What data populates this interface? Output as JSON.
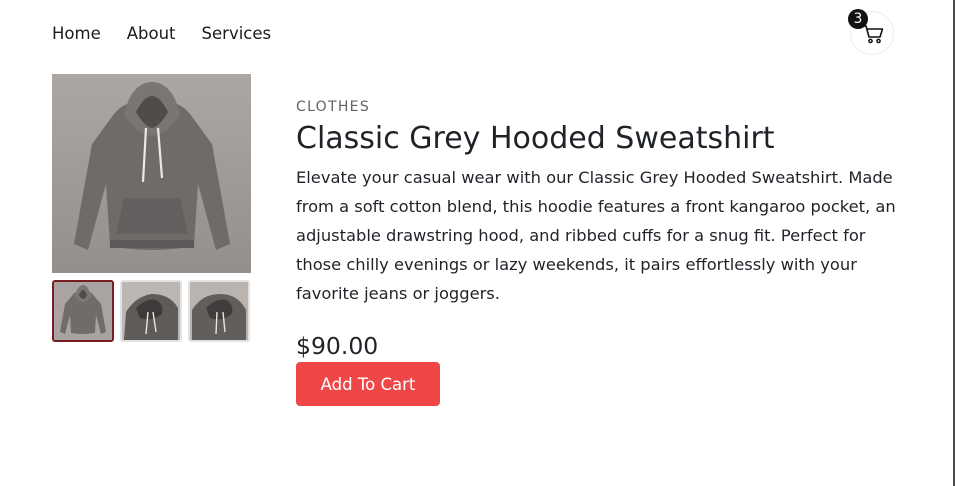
{
  "nav": {
    "items": [
      "Home",
      "About",
      "Services"
    ]
  },
  "cart": {
    "count": "3",
    "icon": "cart-icon"
  },
  "product": {
    "category": "CLOTHES",
    "title": "Classic Grey Hooded Sweatshirt",
    "description": "Elevate your casual wear with our Classic Grey Hooded Sweatshirt. Made from a soft cotton blend, this hoodie features a front kangaroo pocket, an adjustable drawstring hood, and ribbed cuffs for a snug fit. Perfect for those chilly evenings or lazy weekends, it pairs effortlessly with your favorite jeans or joggers.",
    "price": "$90.00",
    "add_to_cart_label": "Add To Cart",
    "selected_image": 1,
    "image_count": 3
  },
  "colors": {
    "accent": "#ef4748",
    "active_thumb_border": "#7a1d22",
    "badge": "#111111"
  }
}
